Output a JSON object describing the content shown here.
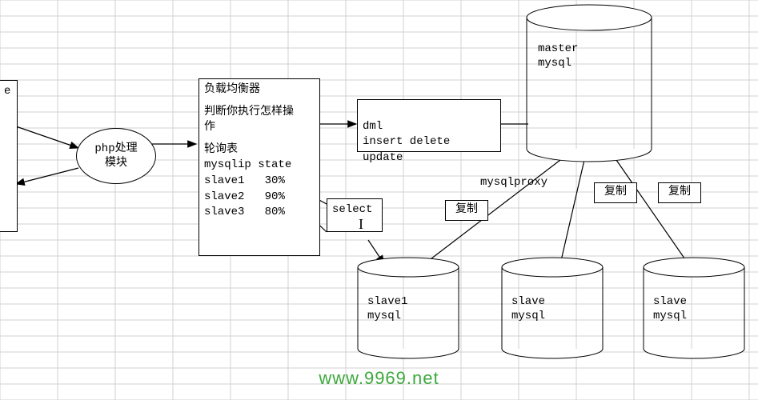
{
  "left_box_fragment": "e",
  "php_module": "php处理\n模块",
  "load_balancer": {
    "title": "负载均衡器",
    "sub1": "判断你执行怎样操\n作",
    "sub2": "轮询表",
    "table_header": "mysqlip state",
    "rows": [
      {
        "name": "slave1",
        "state": "30%"
      },
      {
        "name": "slave2",
        "state": "90%"
      },
      {
        "name": "slave3",
        "state": "80%"
      }
    ]
  },
  "select_box": "select",
  "dml_box": "dml\ninsert delete\nupdate",
  "proxy_label": "mysqlproxy",
  "copy_label": "复制",
  "cylinders": {
    "master": "master\nmysql",
    "slave1": "slave1\nmysql",
    "slave2": "slave\nmysql",
    "slave3": "slave\nmysql"
  },
  "watermark": "www.9969.net"
}
